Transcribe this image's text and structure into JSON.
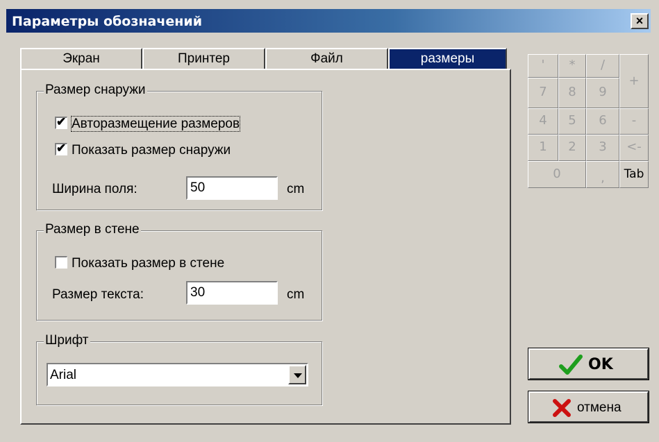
{
  "window": {
    "title": "Параметры обозначений",
    "close_glyph": "×"
  },
  "tabs": [
    {
      "label": "Экран"
    },
    {
      "label": "Принтер"
    },
    {
      "label": "Файл"
    },
    {
      "label": "размеры"
    }
  ],
  "outer_group": {
    "title": "Размер снаружи",
    "auto_placement": {
      "label": "Авторазмещение размеров",
      "checked": true
    },
    "show_outside": {
      "label": "Показать размер снаружи",
      "checked": true
    },
    "field_width": {
      "label": "Ширина поля:",
      "value": "50",
      "unit": "cm"
    }
  },
  "wall_group": {
    "title": "Размер в стене",
    "show_in_wall": {
      "label": "Показать размер в стене",
      "checked": false
    },
    "text_size": {
      "label": "Размер текста:",
      "value": "30",
      "unit": "cm"
    }
  },
  "font_group": {
    "title": "Шрифт",
    "selected": "Arial"
  },
  "keypad": {
    "keys": [
      "'",
      "*",
      "/",
      "+",
      "7",
      "8",
      "9",
      "4",
      "5",
      "6",
      "-",
      "1",
      "2",
      "3",
      "<-",
      "0",
      ",",
      "Tab"
    ]
  },
  "buttons": {
    "ok": "OK",
    "cancel": "отмена"
  },
  "colors": {
    "title_start": "#0a246a",
    "title_end": "#a6caf0",
    "active_tab": "#0a246a",
    "face": "#d4d0c8",
    "ok_check": "#1e9e1e",
    "cancel_x": "#cc1111"
  }
}
